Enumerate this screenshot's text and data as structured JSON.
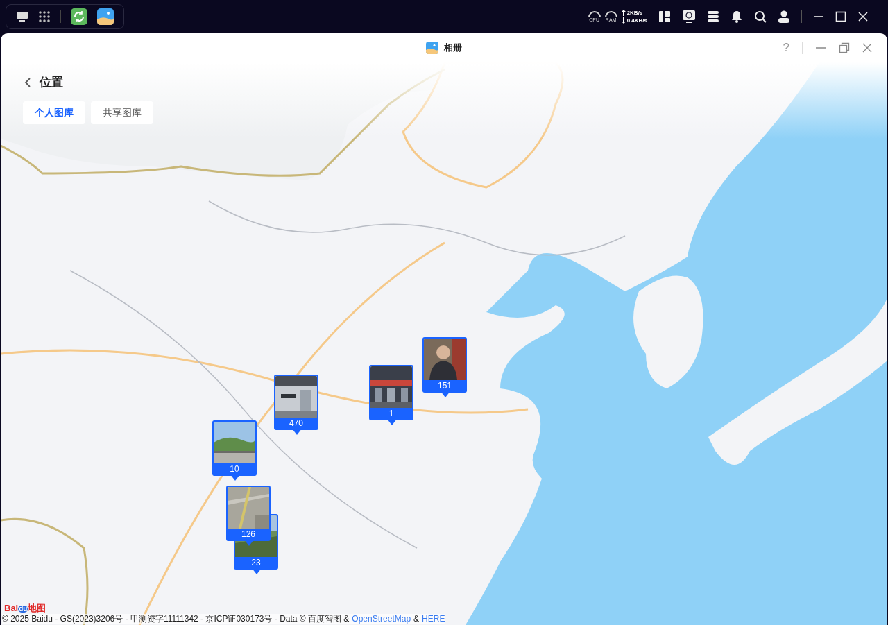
{
  "taskbar": {
    "net_up": "2KB/s",
    "net_down": "0.4KB/s",
    "cpu_label": "CPU",
    "ram_label": "RAM"
  },
  "window": {
    "title": "相册",
    "help": "?"
  },
  "page": {
    "title": "位置"
  },
  "tabs": [
    {
      "label": "个人图库",
      "selected": true
    },
    {
      "label": "共享图库",
      "selected": false
    }
  ],
  "markers": [
    {
      "count": "23",
      "kind": "picture"
    },
    {
      "count": "126",
      "kind": "picture"
    },
    {
      "count": "10",
      "kind": "picture"
    },
    {
      "count": "470",
      "kind": "picture"
    },
    {
      "count": "1",
      "kind": "picture"
    },
    {
      "count": "151",
      "kind": "picture"
    }
  ],
  "map_logo": [
    "Bai",
    "du",
    "地图"
  ],
  "attribution": {
    "text": "© 2025 Baidu - GS(2023)3206号 - 甲测资字11111342 - 京ICP证030173号 - Data © 百度智图 &",
    "links": [
      "OpenStreetMap",
      "HERE"
    ],
    "separator": "&"
  }
}
